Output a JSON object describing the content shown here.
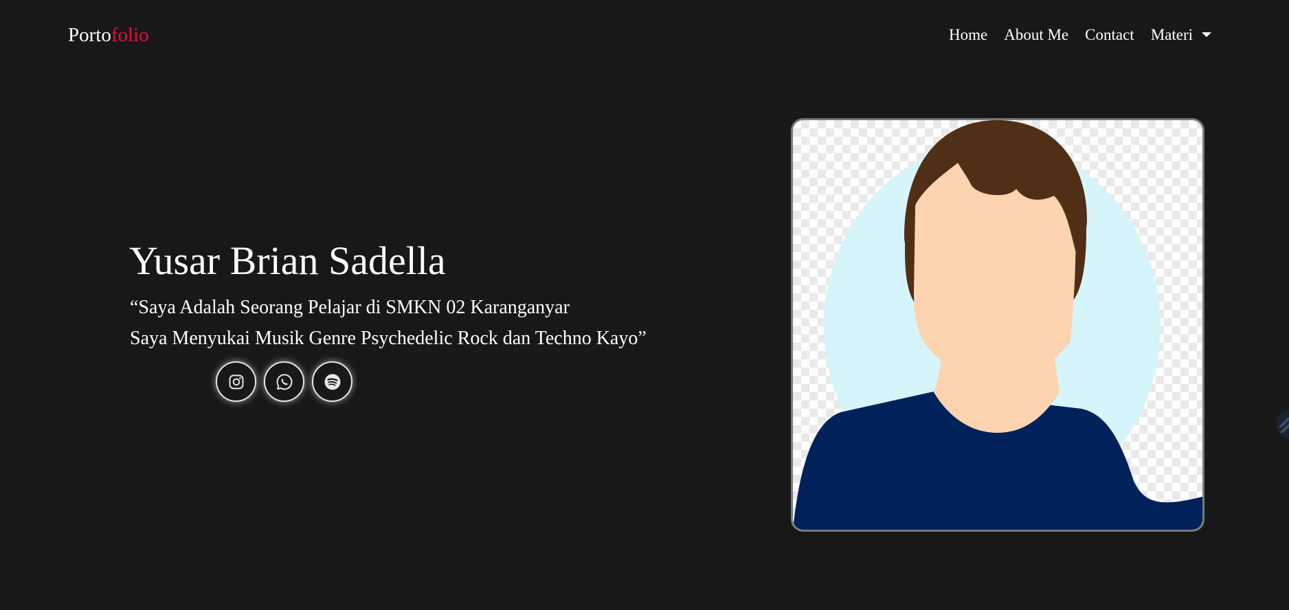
{
  "navbar": {
    "brand_primary": "Porto",
    "brand_accent": "folio",
    "links": [
      {
        "label": "Home"
      },
      {
        "label": "About Me"
      },
      {
        "label": "Contact"
      },
      {
        "label": "Materi"
      }
    ]
  },
  "hero": {
    "name": "Yusar Brian Sadella",
    "quote_line_1": "“Saya Adalah Seorang Pelajar di SMKN 02 Karanganyar",
    "quote_line_2": "Saya Menyukai Musik Genre Psychedelic Rock dan Techno Kayo”"
  },
  "socials": [
    {
      "icon": "instagram-icon"
    },
    {
      "icon": "whatsapp-icon"
    },
    {
      "icon": "spotify-icon"
    }
  ],
  "profile": {
    "avatar": "profile-avatar-illustration"
  },
  "colors": {
    "background": "#181818",
    "text": "#ffffff",
    "brand_accent": "#dc143c",
    "avatar_bg_circle": "#d6f5fb",
    "avatar_skin": "#fdd3b0",
    "avatar_hair": "#512e16",
    "avatar_shirt": "#00215a"
  }
}
